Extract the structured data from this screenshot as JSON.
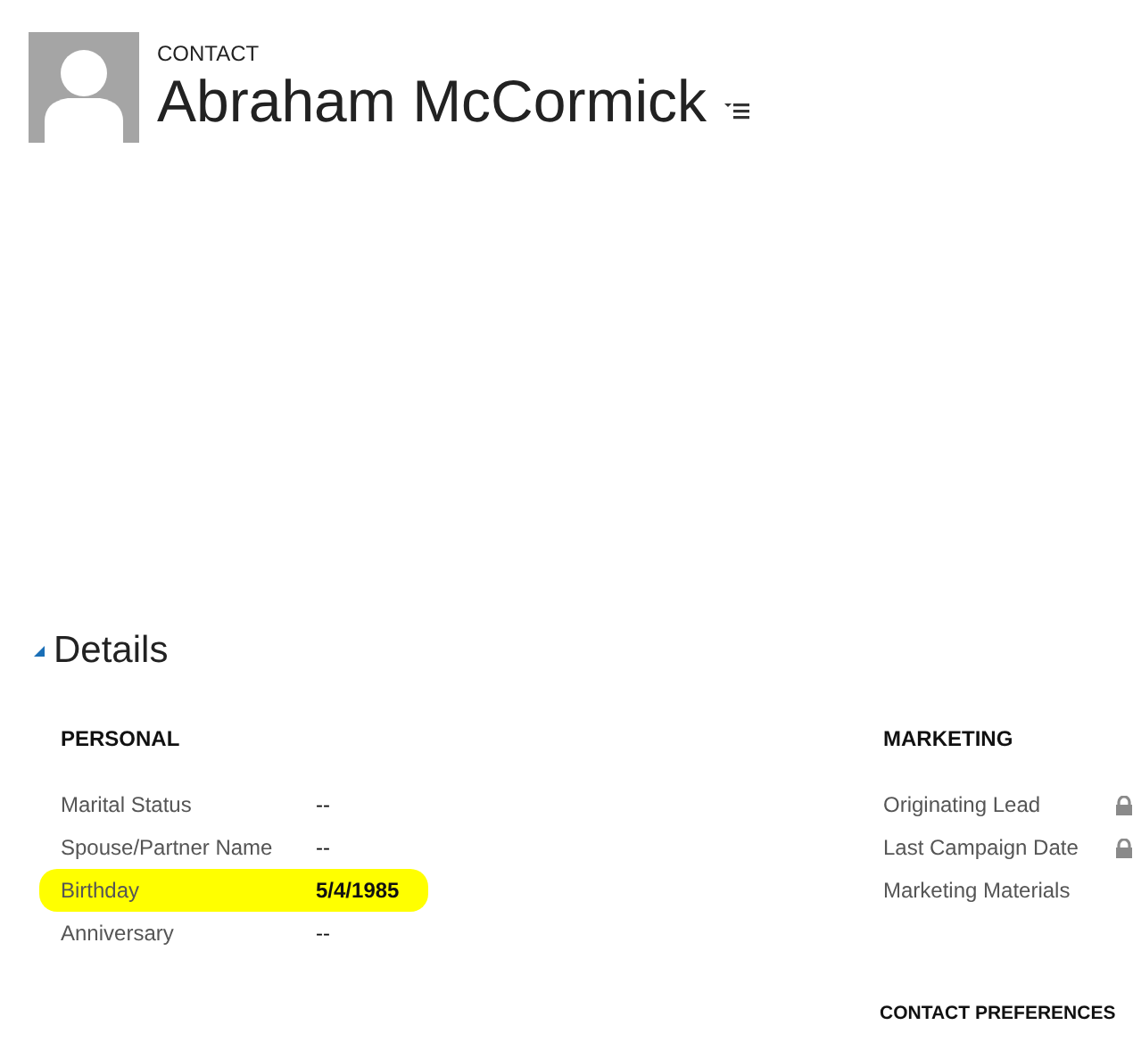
{
  "header": {
    "entity": "CONTACT",
    "name": "Abraham McCormick"
  },
  "section": {
    "title": "Details",
    "expanded": true
  },
  "personal": {
    "heading": "PERSONAL",
    "fields": [
      {
        "label": "Marital Status",
        "value": "--",
        "highlighted": false
      },
      {
        "label": "Spouse/Partner Name",
        "value": "--",
        "highlighted": false
      },
      {
        "label": "Birthday",
        "value": "5/4/1985",
        "highlighted": true
      },
      {
        "label": "Anniversary",
        "value": "--",
        "highlighted": false
      }
    ]
  },
  "marketing": {
    "heading": "MARKETING",
    "fields": [
      {
        "label": "Originating Lead",
        "locked": true
      },
      {
        "label": "Last Campaign Date",
        "locked": true
      },
      {
        "label": "Marketing Materials",
        "locked": false
      }
    ]
  },
  "contact_preferences": {
    "heading": "CONTACT PREFERENCES"
  }
}
